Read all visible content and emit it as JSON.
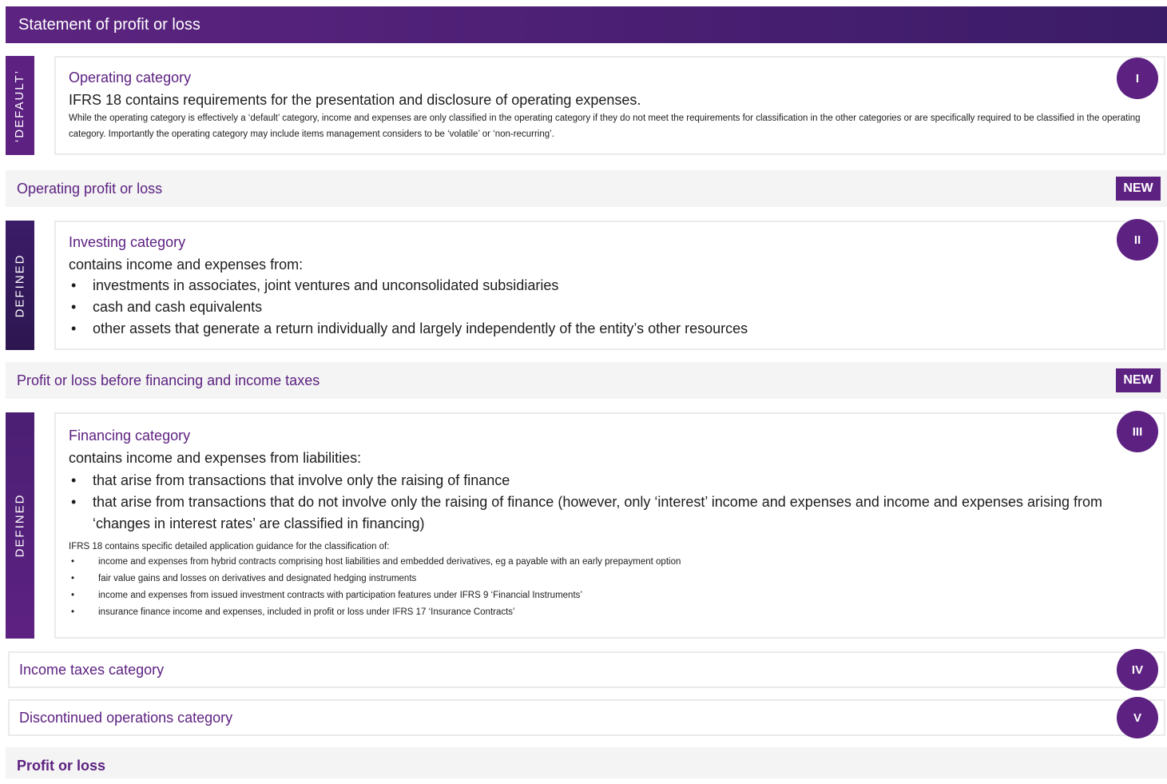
{
  "header": {
    "title": "Statement of profit or loss"
  },
  "operating": {
    "side_label": "‘DEFAULT’",
    "title": "Operating category",
    "lead": "IFRS 18 contains requirements for the presentation and disclosure of operating expenses.",
    "note": "While the operating category is effectively a ‘default’ category, income and expenses are only classified in the operating category if they do not meet the requirements for classification in the other categories or are specifically required to be classified in the operating category. Importantly the operating category may include items management considers to be ‘volatile’ or ‘non-recurring’.",
    "badge": "I"
  },
  "subtotal_1": {
    "label": "Operating profit or loss",
    "tag": "NEW"
  },
  "investing": {
    "side_label": "DEFINED",
    "title": "Investing category",
    "lead": "contains income and expenses from:",
    "items": [
      "investments in associates, joint ventures and unconsolidated subsidiaries",
      "cash and cash equivalents",
      "other assets that generate a return individually and largely independently of the entity’s other resources"
    ],
    "badge": "II"
  },
  "subtotal_2": {
    "label": "Profit or loss before financing and income taxes",
    "tag": "NEW"
  },
  "financing": {
    "side_label": "DEFINED",
    "title": "Financing category",
    "lead": "contains income and expenses from liabilities:",
    "items": [
      "that arise from transactions that involve only the raising of finance",
      "that arise from transactions that do not involve only the raising of finance (however, only ‘interest’ income and expenses and income and expenses arising from ‘changes in interest rates’ are classified in financing)"
    ],
    "guidance_intro": "IFRS 18 contains specific detailed application guidance for the classification of:",
    "guidance_items": [
      "income and expenses from hybrid contracts comprising host liabilities and embedded derivatives, eg a payable with an early prepayment option",
      "fair value gains and losses on derivatives and designated hedging instruments",
      "income and expenses from issued investment contracts with participation features under IFRS 9 ‘Financial Instruments’",
      "insurance finance income and expenses, included in profit or loss under IFRS 17 ‘Insurance Contracts’"
    ],
    "badge": "III"
  },
  "income_taxes": {
    "label": "Income taxes category",
    "badge": "IV"
  },
  "discontinued": {
    "label": "Discontinued operations category",
    "badge": "V"
  },
  "total": {
    "label": "Profit or loss"
  }
}
